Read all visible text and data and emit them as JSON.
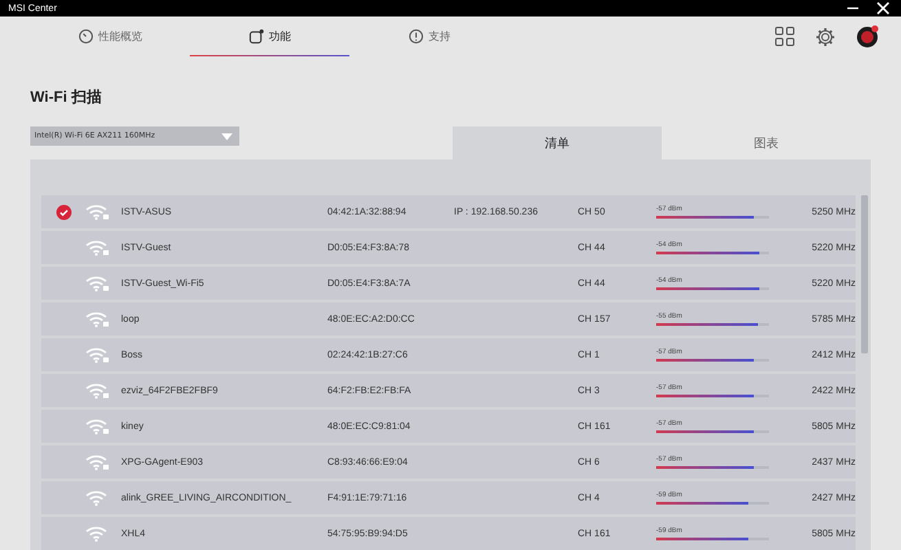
{
  "window": {
    "title": "MSI Center"
  },
  "nav": [
    {
      "label": "性能概览",
      "selected": false
    },
    {
      "label": "功能",
      "selected": true
    },
    {
      "label": "支持",
      "selected": false
    }
  ],
  "page_title": "Wi-Fi 扫描",
  "adapter": {
    "value": "Intel(R) Wi-Fi 6E AX211 160MHz"
  },
  "view_tabs": [
    {
      "label": "清单",
      "selected": true
    },
    {
      "label": "图表",
      "selected": false
    }
  ],
  "networks": [
    {
      "connected": true,
      "secured": true,
      "ssid": "ISTV-ASUS",
      "mac": "04:42:1A:32:88:94",
      "ip": "IP : 192.168.50.236",
      "channel": "CH 50",
      "dbm": "-57 dBm",
      "level": 0.87,
      "freq": "5250 MHz"
    },
    {
      "connected": false,
      "secured": true,
      "ssid": "ISTV-Guest",
      "mac": "D0:05:E4:F3:8A:78",
      "channel": "CH 44",
      "dbm": "-54 dBm",
      "level": 0.92,
      "freq": "5220 MHz"
    },
    {
      "connected": false,
      "secured": true,
      "ssid": "ISTV-Guest_Wi-Fi5",
      "mac": "D0:05:E4:F3:8A:7A",
      "channel": "CH 44",
      "dbm": "-54 dBm",
      "level": 0.92,
      "freq": "5220 MHz"
    },
    {
      "connected": false,
      "secured": true,
      "ssid": "loop",
      "mac": "48:0E:EC:A2:D0:CC",
      "channel": "CH 157",
      "dbm": "-55 dBm",
      "level": 0.9,
      "freq": "5785 MHz"
    },
    {
      "connected": false,
      "secured": true,
      "ssid": "Boss",
      "mac": "02:24:42:1B:27:C6",
      "channel": "CH 1",
      "dbm": "-57 dBm",
      "level": 0.87,
      "freq": "2412 MHz"
    },
    {
      "connected": false,
      "secured": true,
      "ssid": "ezviz_64F2FBE2FBF9",
      "mac": "64:F2:FB:E2:FB:FA",
      "channel": "CH 3",
      "dbm": "-57 dBm",
      "level": 0.87,
      "freq": "2422 MHz"
    },
    {
      "connected": false,
      "secured": true,
      "ssid": "kiney",
      "mac": "48:0E:EC:C9:81:04",
      "channel": "CH 161",
      "dbm": "-57 dBm",
      "level": 0.87,
      "freq": "5805 MHz"
    },
    {
      "connected": false,
      "secured": true,
      "ssid": "XPG-GAgent-E903",
      "mac": "C8:93:46:66:E9:04",
      "channel": "CH 6",
      "dbm": "-57 dBm",
      "level": 0.87,
      "freq": "2437 MHz"
    },
    {
      "connected": false,
      "secured": false,
      "ssid": "alink_GREE_LIVING_AIRCONDITION_",
      "mac": "F4:91:1E:79:71:16",
      "channel": "CH 4",
      "dbm": "-59 dBm",
      "level": 0.82,
      "freq": "2427 MHz"
    },
    {
      "connected": false,
      "secured": false,
      "ssid": "XHL4",
      "mac": "54:75:95:B9:94:D5",
      "channel": "CH 161",
      "dbm": "-59 dBm",
      "level": 0.82,
      "freq": "5805 MHz"
    }
  ]
}
